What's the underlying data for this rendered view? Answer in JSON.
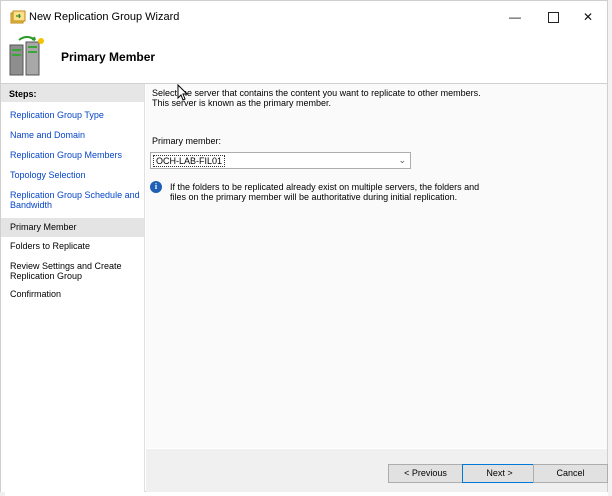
{
  "window": {
    "title": "New Replication Group Wizard",
    "minimize_label": "—",
    "close_label": "✕"
  },
  "header": {
    "title": "Primary Member"
  },
  "steps": {
    "heading": "Steps:",
    "items": [
      {
        "label": "Replication Group Type",
        "state": "link"
      },
      {
        "label": "Name and Domain",
        "state": "link"
      },
      {
        "label": "Replication Group Members",
        "state": "link"
      },
      {
        "label": "Topology Selection",
        "state": "link"
      },
      {
        "label": "Replication Group Schedule and Bandwidth",
        "state": "link"
      },
      {
        "label": "Primary Member",
        "state": "current"
      },
      {
        "label": "Folders to Replicate",
        "state": "pending"
      },
      {
        "label": "Review Settings and Create Replication Group",
        "state": "pending"
      },
      {
        "label": "Confirmation",
        "state": "pending"
      }
    ]
  },
  "content": {
    "intro_line1": "Select the server that contains the content you want to replicate to other members.",
    "intro_line2": "This server is known as the primary member.",
    "primary_member_label": "Primary member:",
    "primary_member_value": "OCH-LAB-FIL01",
    "info_line1": "If the folders to be replicated already exist on multiple servers, the folders and",
    "info_line2": "files on the primary member will be authoritative during initial replication."
  },
  "buttons": {
    "previous": "< Previous",
    "next": "Next >",
    "cancel": "Cancel"
  },
  "colors": {
    "link": "#0645c8",
    "accent": "#0078d7"
  }
}
